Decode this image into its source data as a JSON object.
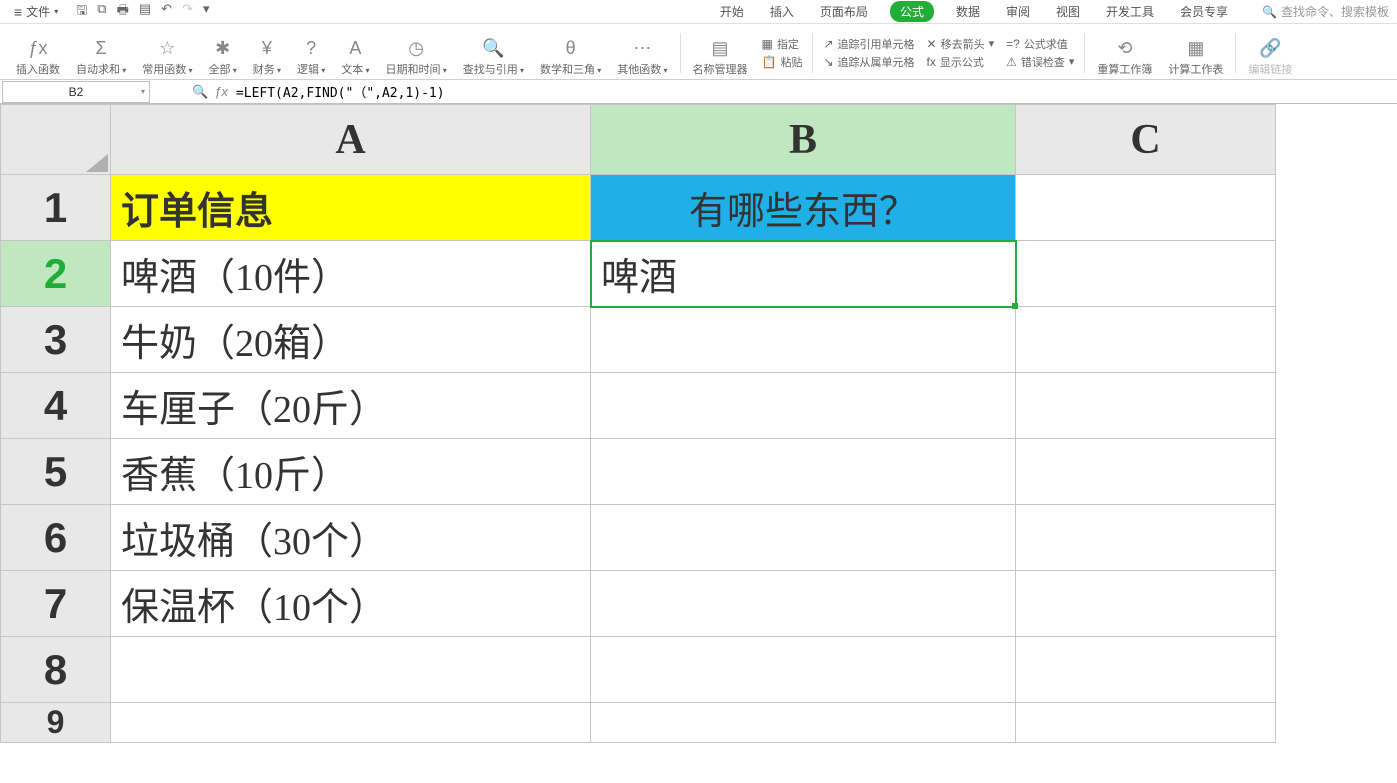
{
  "menubar": {
    "file": "文件",
    "tabs": [
      "开始",
      "插入",
      "页面布局",
      "公式",
      "数据",
      "审阅",
      "视图",
      "开发工具",
      "会员专享"
    ],
    "active_tab": "公式",
    "search_placeholder": "查找命令、搜索模板"
  },
  "ribbon": {
    "insert_fn": "插入函数",
    "autosum": "自动求和",
    "common": "常用函数",
    "all": "全部",
    "financial": "财务",
    "logical": "逻辑",
    "text": "文本",
    "datetime": "日期和时间",
    "lookup": "查找与引用",
    "math": "数学和三角",
    "other": "其他函数",
    "name_mgr": "名称管理器",
    "define": "指定",
    "paste": "粘贴",
    "trace_prec": "追踪引用单元格",
    "trace_dep": "追踪从属单元格",
    "remove_arrows": "移去箭头",
    "show_formula": "显示公式",
    "evaluate": "公式求值",
    "error_check": "错误检查",
    "recalc_wb": "重算工作簿",
    "calc_ws": "计算工作表",
    "edit_links": "编辑链接"
  },
  "name_box": "B2",
  "formula": "=LEFT(A2,FIND(\"（\",A2,1)-1)",
  "cols": {
    "A": "A",
    "B": "B",
    "C": "C"
  },
  "rows": {
    "1": {
      "A": "订单信息",
      "B": "有哪些东西？",
      "C": ""
    },
    "2": {
      "A": "啤酒（10件）",
      "B": "啤酒",
      "C": ""
    },
    "3": {
      "A": "牛奶（20箱）",
      "B": "",
      "C": ""
    },
    "4": {
      "A": "车厘子（20斤）",
      "B": "",
      "C": ""
    },
    "5": {
      "A": "香蕉（10斤）",
      "B": "",
      "C": ""
    },
    "6": {
      "A": "垃圾桶（30个）",
      "B": "",
      "C": ""
    },
    "7": {
      "A": "保温杯（10个）",
      "B": "",
      "C": ""
    },
    "8": {
      "A": "",
      "B": "",
      "C": ""
    }
  },
  "chart_data": {
    "type": "table",
    "title": "订单信息",
    "columns": [
      "订单信息",
      "有哪些东西？"
    ],
    "rows": [
      [
        "啤酒（10件）",
        "啤酒"
      ],
      [
        "牛奶（20箱）",
        ""
      ],
      [
        "车厘子（20斤）",
        ""
      ],
      [
        "香蕉（10斤）",
        ""
      ],
      [
        "垃圾桶（30个）",
        ""
      ],
      [
        "保温杯（10个）",
        ""
      ]
    ]
  }
}
